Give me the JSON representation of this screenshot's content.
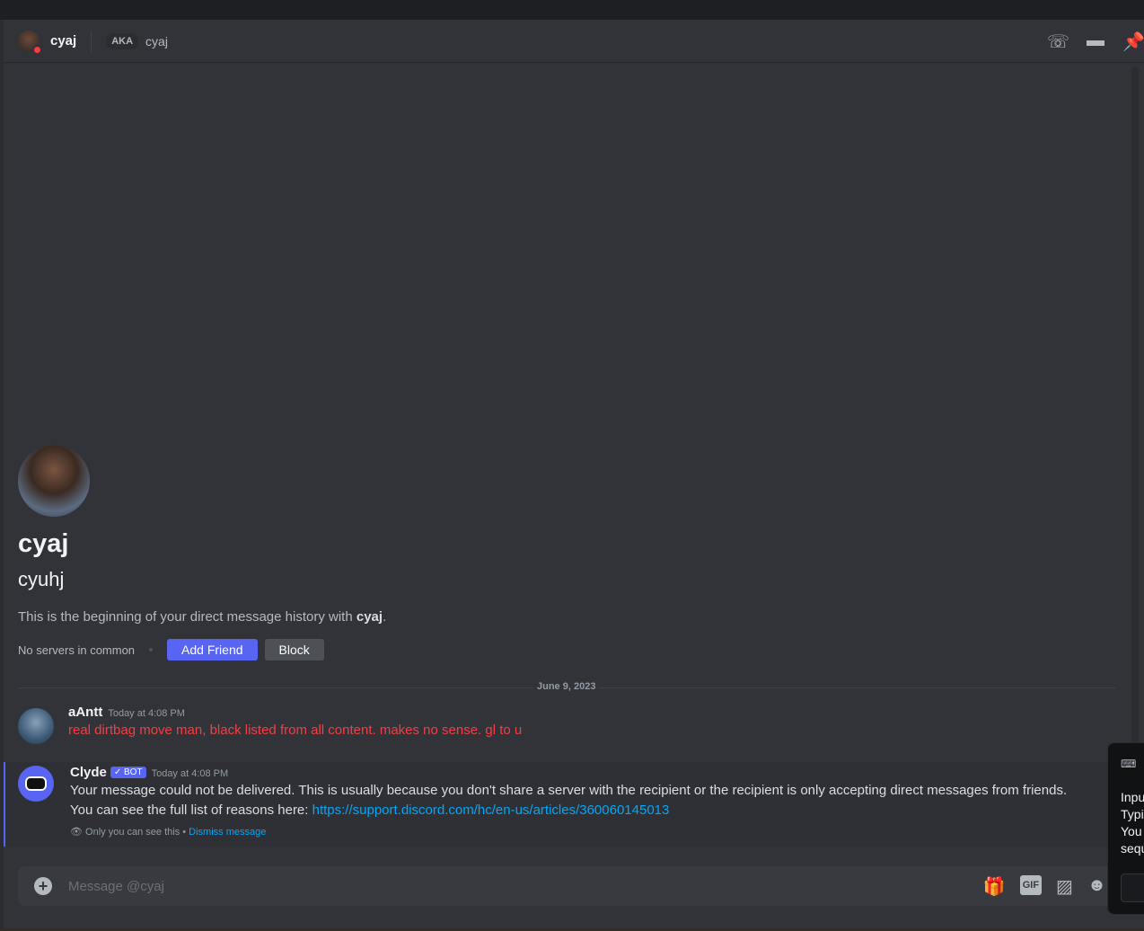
{
  "header": {
    "username": "cyaj",
    "aka_label": "AKA",
    "aka_name": "cyaj",
    "icons": [
      "phone-call-icon",
      "video-icon",
      "pin-icon"
    ]
  },
  "intro": {
    "display_name": "cyaj",
    "username": "cyuhj",
    "description_prefix": "This is the beginning of your direct message history with ",
    "description_name": "cyaj",
    "description_suffix": ".",
    "servers": "No servers in common",
    "add_friend": "Add Friend",
    "block": "Block"
  },
  "date_divider": "June 9, 2023",
  "messages": [
    {
      "author": "aAntt",
      "timestamp": "Today at 4:08 PM",
      "text": "real dirtbag move man, black listed from all content. makes no sense. gl to u",
      "color": "#f23f43"
    },
    {
      "author": "Clyde",
      "badge": "✓ BOT",
      "timestamp": "Today at 4:08 PM",
      "line1": "Your message could not be delivered. This is usually because you don't share a server with the recipient or the recipient is only accepting direct messages from friends.",
      "line2_prefix": "You can see the full list of reasons here: ",
      "link": "https://support.discord.com/hc/en-us/articles/360060145013",
      "ephemeral": "Only you can see this",
      "dot": " • ",
      "dismiss": "Dismiss message"
    }
  ],
  "composer": {
    "placeholder": "Message @cyaj",
    "gif": "GIF",
    "icons": [
      "gift-icon",
      "gif-icon",
      "sticker-icon",
      "emoji-icon"
    ]
  },
  "popup": {
    "lines": [
      "Inpu",
      "Typi",
      "You",
      "sequ"
    ]
  },
  "colors": {
    "accent": "#5865f2",
    "link": "#00a8fc",
    "danger": "#f23f43"
  }
}
